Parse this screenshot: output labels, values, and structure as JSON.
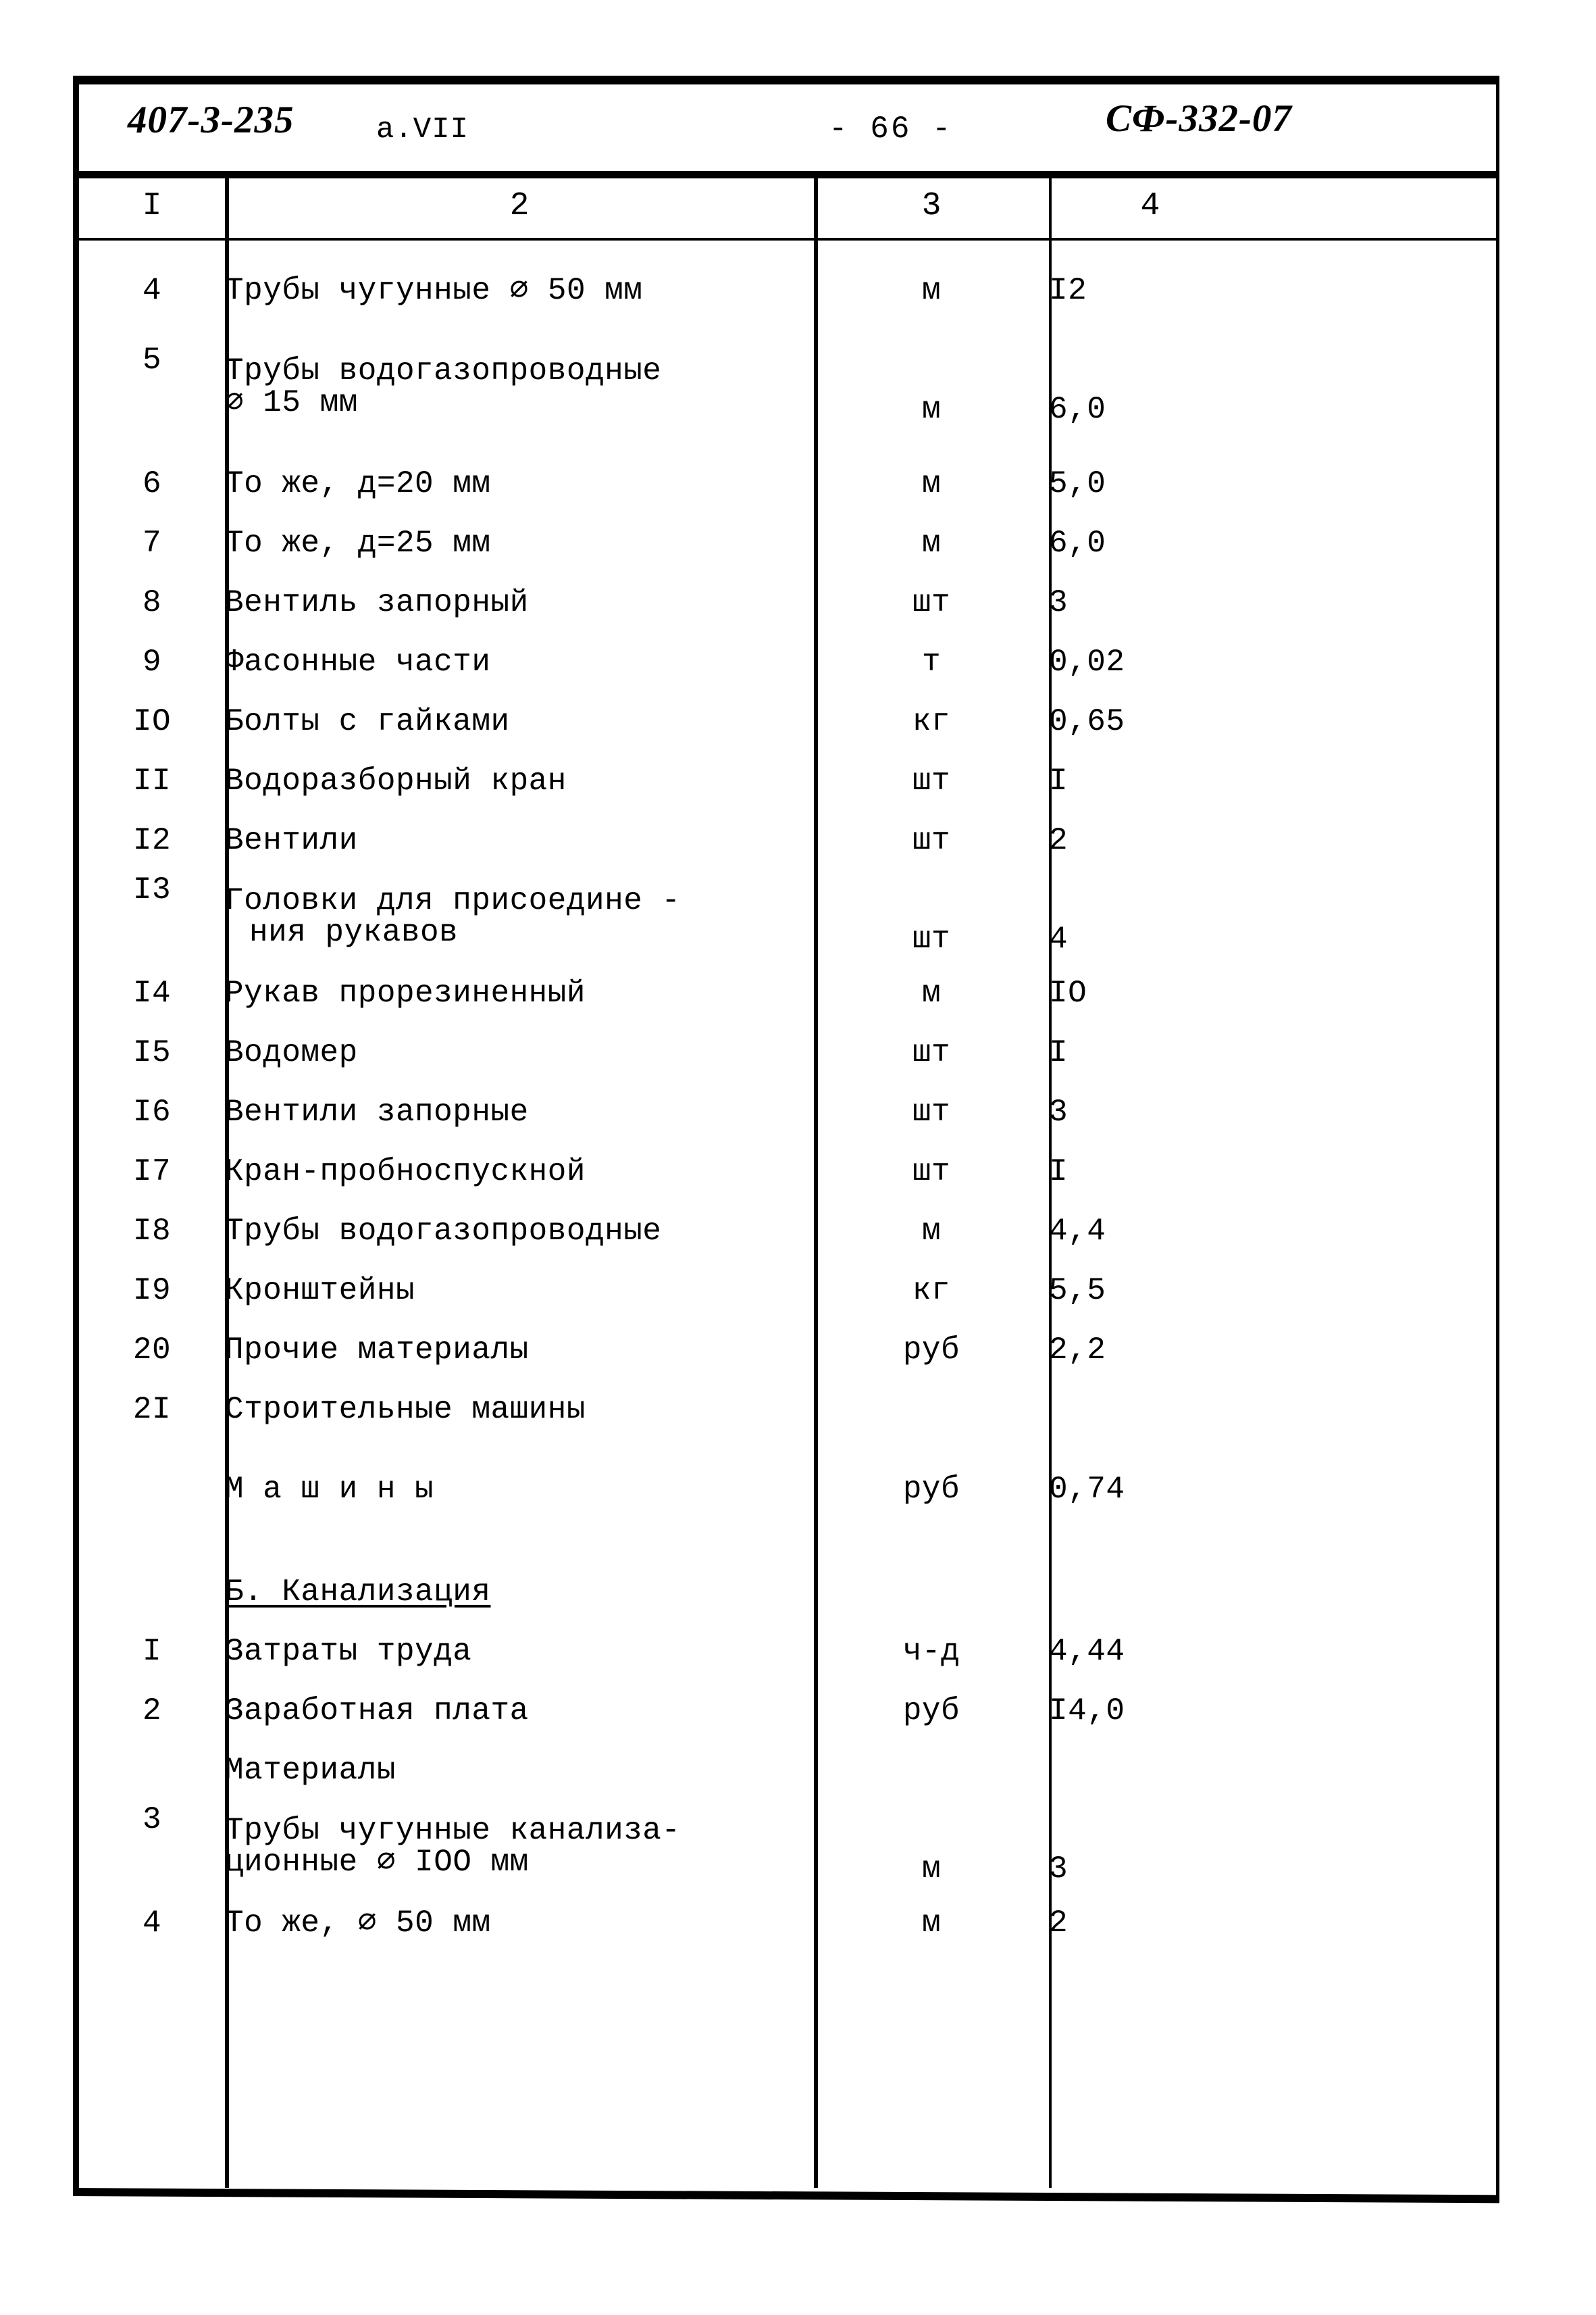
{
  "header": {
    "document_number": "407-3-235",
    "album": "а.VII",
    "page_label": "- 66 -",
    "sheet_code": "СФ-332-07"
  },
  "table": {
    "column_numbers": [
      "I",
      "2",
      "3",
      "4"
    ],
    "rows": [
      {
        "num": "4",
        "name": "Трубы чугунные ⌀ 50 мм",
        "name2": "",
        "unit": "м",
        "qty": "I2"
      },
      {
        "num": "5",
        "name": "Трубы водогазопроводные",
        "name2": "⌀ 15 мм",
        "unit": "м",
        "qty": "6,0"
      },
      {
        "num": "6",
        "name": "То же, д=20 мм",
        "name2": "",
        "unit": "м",
        "qty": "5,0"
      },
      {
        "num": "7",
        "name": "То же, д=25 мм",
        "name2": "",
        "unit": "м",
        "qty": "6,0"
      },
      {
        "num": "8",
        "name": "Вентиль запорный",
        "name2": "",
        "unit": "шт",
        "qty": "3"
      },
      {
        "num": "9",
        "name": "Фасонные части",
        "name2": "",
        "unit": "т",
        "qty": "0,02"
      },
      {
        "num": "IO",
        "name": "Болты с гайками",
        "name2": "",
        "unit": "кг",
        "qty": "0,65"
      },
      {
        "num": "II",
        "name": "Водоразборный кран",
        "name2": "",
        "unit": "шт",
        "qty": "I"
      },
      {
        "num": "I2",
        "name": "Вентили",
        "name2": "",
        "unit": "шт",
        "qty": "2"
      },
      {
        "num": "I3",
        "name": "Головки для присоедине -",
        "name2": "ния рукавов",
        "unit": "шт",
        "qty": "4"
      },
      {
        "num": "I4",
        "name": "Рукав прорезиненный",
        "name2": "",
        "unit": "м",
        "qty": "IO"
      },
      {
        "num": "I5",
        "name": "Водомер",
        "name2": "",
        "unit": "шт",
        "qty": "I"
      },
      {
        "num": "I6",
        "name": "Вентили запорные",
        "name2": "",
        "unit": "шт",
        "qty": "3"
      },
      {
        "num": "I7",
        "name": "Кран-пробноспускной",
        "name2": "",
        "unit": "шт",
        "qty": "I"
      },
      {
        "num": "I8",
        "name": "Трубы водогазопроводные",
        "name2": "",
        "unit": "м",
        "qty": "4,4"
      },
      {
        "num": "I9",
        "name": "Кронштейны",
        "name2": "",
        "unit": "кг",
        "qty": "5,5"
      },
      {
        "num": "20",
        "name": "Прочие материалы",
        "name2": "",
        "unit": "руб",
        "qty": "2,2"
      },
      {
        "num": "2I",
        "name": "Строительные машины",
        "name2": "",
        "unit": "",
        "qty": ""
      },
      {
        "num": "",
        "name": "М а ш и н ы",
        "name2": "",
        "unit": "руб",
        "qty": "0,74"
      },
      {
        "num": "",
        "name": "Б. Канализация",
        "name2": "",
        "unit": "",
        "qty": ""
      },
      {
        "num": "I",
        "name": "Затраты труда",
        "name2": "",
        "unit": "ч-д",
        "qty": "4,44"
      },
      {
        "num": "2",
        "name": "Заработная плата",
        "name2": "",
        "unit": "руб",
        "qty": "I4,0"
      },
      {
        "num": "",
        "name": "Материалы",
        "name2": "",
        "unit": "",
        "qty": ""
      },
      {
        "num": "3",
        "name": "Трубы чугунные канализа-",
        "name2": "ционные ⌀ IOO мм",
        "unit": "м",
        "qty": "3"
      },
      {
        "num": "4",
        "name": "То же, ⌀ 50 мм",
        "name2": "",
        "unit": "м",
        "qty": "2"
      }
    ]
  }
}
